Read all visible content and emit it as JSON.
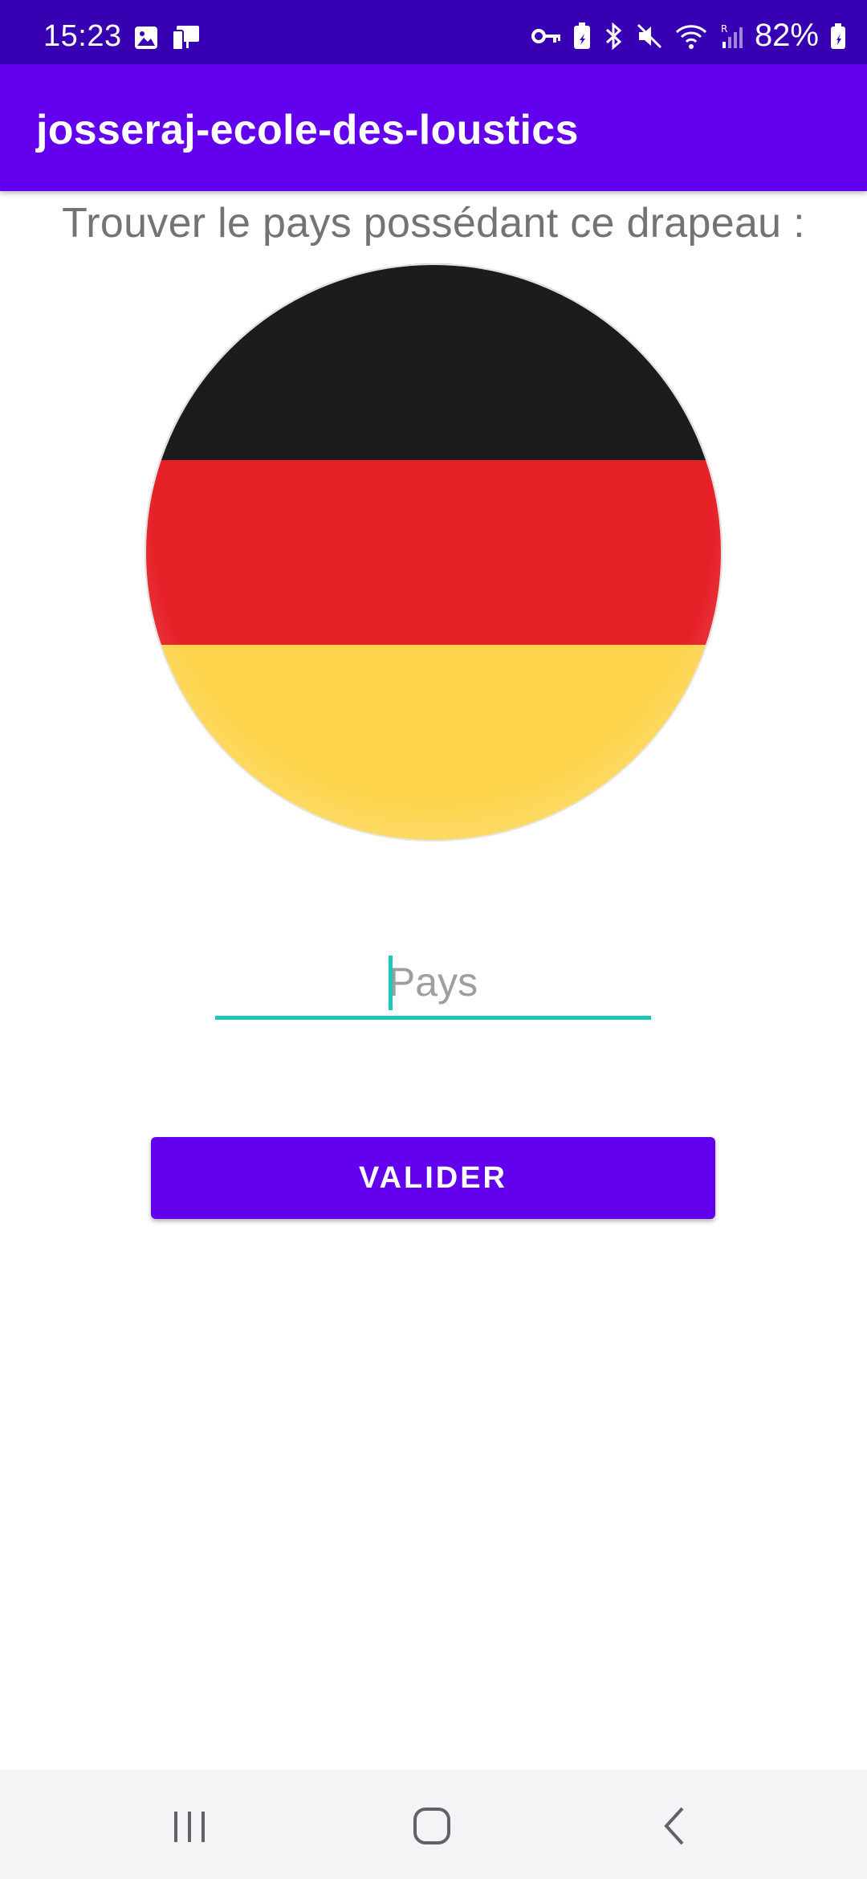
{
  "status_bar": {
    "time": "15:23",
    "battery": "82%",
    "icons_left": [
      "gallery-icon",
      "device-icon"
    ],
    "icons_right": [
      "vpn-key-icon",
      "battery-saver-icon",
      "bluetooth-icon",
      "mute-icon",
      "wifi-icon",
      "signal-icon",
      "battery-icon"
    ]
  },
  "app_bar": {
    "title": "josseraj-ecole-des-loustics",
    "color": "#6200ee"
  },
  "quiz": {
    "question": "Trouver le pays possédant ce drapeau :",
    "flag": {
      "description_icon": "germany-flag-icon",
      "stripes": [
        "#1c1c1c",
        "#e62027",
        "#fdd44c"
      ]
    },
    "input": {
      "placeholder": "Pays",
      "value": ""
    },
    "submit_label": "VALIDER"
  },
  "nav_bar": {
    "buttons": [
      "recents-icon",
      "home-icon",
      "back-icon"
    ]
  },
  "colors": {
    "status_bar": "#3700b3",
    "primary": "#6200ee",
    "accent": "#1ec8b9"
  }
}
